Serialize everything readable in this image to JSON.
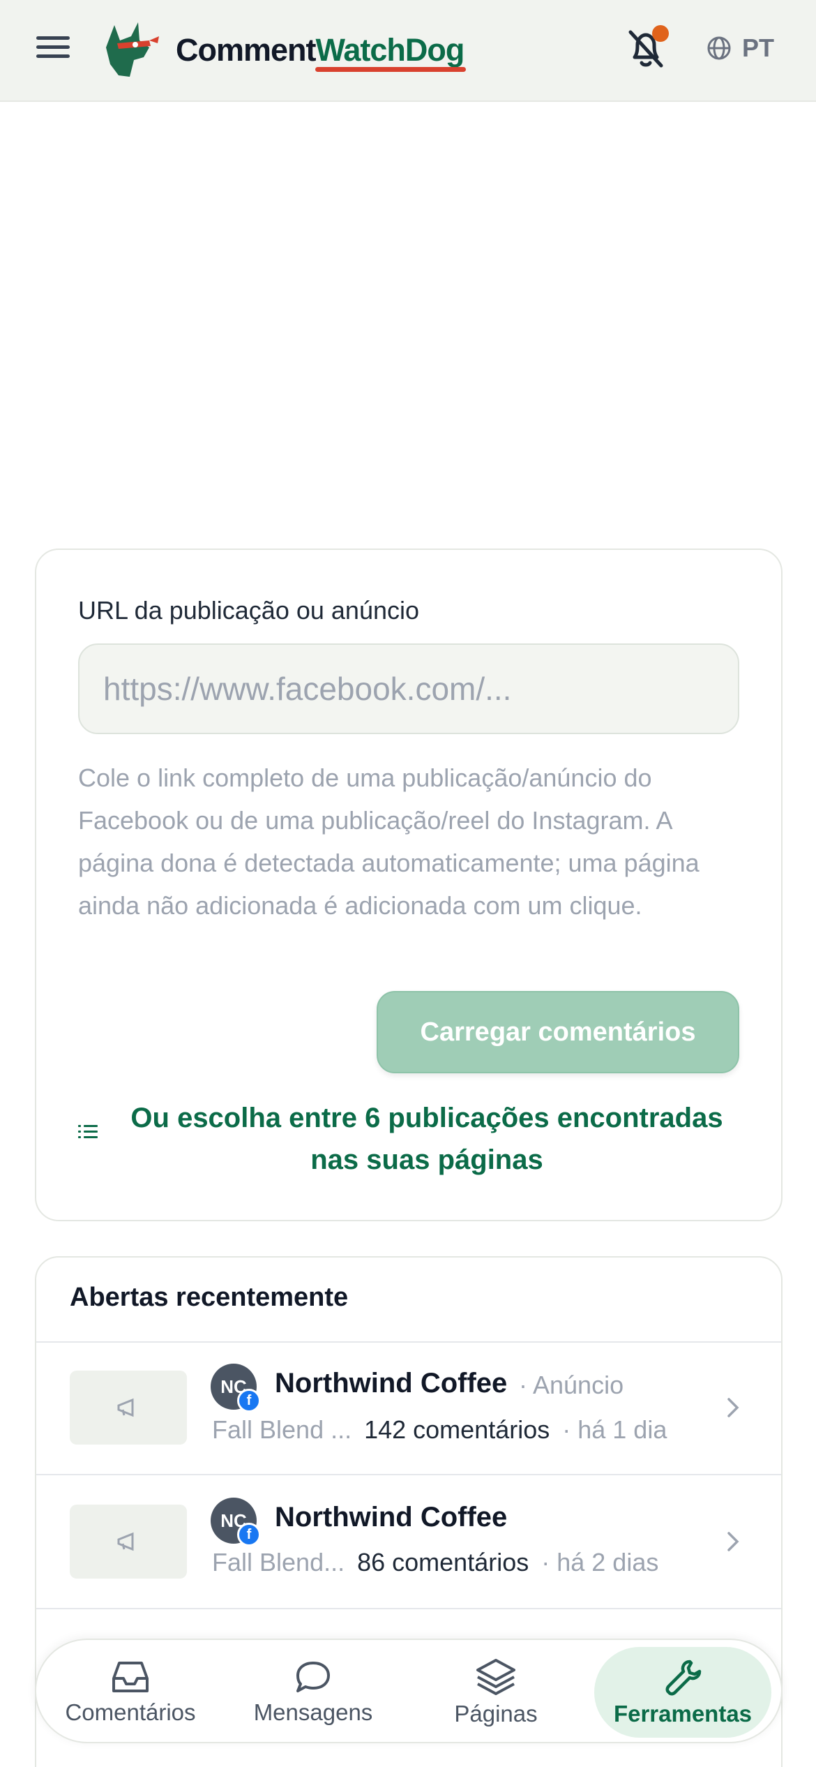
{
  "header": {
    "brand_part1": "Comment",
    "brand_part2": "WatchDog",
    "language": "PT",
    "icons": [
      "menu-icon",
      "dog-logo",
      "bell-off-icon",
      "globe-icon"
    ]
  },
  "load_card": {
    "field_label": "URL da publicação ou anúncio",
    "url_placeholder": "https://www.facebook.com/...",
    "url_value": "",
    "help_text": "Cole o link completo de uma publicação/anúncio do Facebook ou de uma publicação/reel do Instagram. A página dona é detectada automaticamente; uma página ainda não adicionada é adicionada com um clique.",
    "load_button": "Carregar comentários",
    "choose_link": "Ou escolha entre 6 publicações encontradas nas suas páginas"
  },
  "recent": {
    "title": "Abertas recentemente",
    "items": [
      {
        "avatar_initials": "NC",
        "page_name": "Northwind Coffee",
        "kind": "· Anúncio",
        "post_title": "Fall Blend ...",
        "comments": "142 comentários",
        "time": "· há 1 dia"
      },
      {
        "avatar_initials": "NC",
        "page_name": "Northwind Coffee",
        "kind": "",
        "post_title": "Fall Blend...",
        "comments": "86 comentários",
        "time": "· há 2 dias"
      }
    ]
  },
  "bottom_nav": {
    "items": [
      {
        "label": "Comentários",
        "icon": "inbox-icon"
      },
      {
        "label": "Mensagens",
        "icon": "chat-bubble-icon"
      },
      {
        "label": "Páginas",
        "icon": "layers-icon"
      },
      {
        "label": "Ferramentas",
        "icon": "wrench-icon"
      }
    ],
    "active": "Ferramentas"
  },
  "colors": {
    "brand_green": "#0b6b48",
    "accent_red": "#d9412e",
    "notification_dot": "#e0631c",
    "button_disabled": "#9fcdb6",
    "facebook_blue": "#1877f2"
  }
}
